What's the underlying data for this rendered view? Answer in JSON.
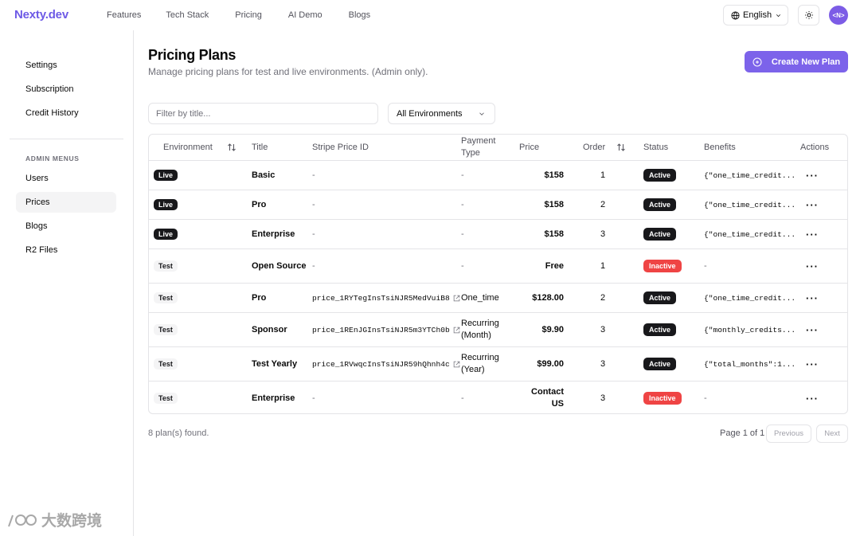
{
  "header": {
    "brand": "Nexty.dev",
    "nav": [
      "Features",
      "Tech Stack",
      "Pricing",
      "AI Demo",
      "Blogs"
    ],
    "language": "English",
    "avatar": "<N>"
  },
  "sidebar": {
    "items": [
      "Settings",
      "Subscription",
      "Credit History"
    ],
    "admin_heading": "ADMIN MENUS",
    "admin_items": [
      "Users",
      "Prices",
      "Blogs",
      "R2 Files"
    ],
    "active": "Prices"
  },
  "main": {
    "title": "Pricing Plans",
    "subtitle": "Manage pricing plans for test and live environments. (Admin only).",
    "create_label": "Create New Plan",
    "filter_placeholder": "Filter by title...",
    "env_select": "All Environments"
  },
  "table": {
    "headers": {
      "environment": "Environment",
      "title": "Title",
      "stripe_price_id": "Stripe Price ID",
      "payment_type": "Payment Type",
      "price": "Price",
      "order": "Order",
      "status": "Status",
      "benefits": "Benefits",
      "actions": "Actions"
    },
    "rows": [
      {
        "env": "Live",
        "title": "Basic",
        "stripe": "-",
        "payment": "-",
        "price": "$158",
        "order": "1",
        "status": "Active",
        "benefits": "{\"one_time_credit..."
      },
      {
        "env": "Live",
        "title": "Pro",
        "stripe": "-",
        "payment": "-",
        "price": "$158",
        "order": "2",
        "status": "Active",
        "benefits": "{\"one_time_credit..."
      },
      {
        "env": "Live",
        "title": "Enterprise",
        "stripe": "-",
        "payment": "-",
        "price": "$158",
        "order": "3",
        "status": "Active",
        "benefits": "{\"one_time_credit..."
      },
      {
        "env": "Test",
        "title": "Open Source",
        "stripe": "-",
        "payment": "-",
        "price": "Free",
        "order": "1",
        "status": "Inactive",
        "benefits": "-"
      },
      {
        "env": "Test",
        "title": "Pro",
        "stripe": "price_1RYTegInsTsiNJR5MedVuiB8",
        "payment": "One_time",
        "price": "$128.00",
        "order": "2",
        "status": "Active",
        "benefits": "{\"one_time_credit..."
      },
      {
        "env": "Test",
        "title": "Sponsor",
        "stripe": "price_1REnJGInsTsiNJR5m3YTCh0b",
        "payment": "Recurring (Month)",
        "price": "$9.90",
        "order": "3",
        "status": "Active",
        "benefits": "{\"monthly_credits..."
      },
      {
        "env": "Test",
        "title": "Test Yearly",
        "stripe": "price_1RVwqcInsTsiNJR59hQhnh4c",
        "payment": "Recurring (Year)",
        "price": "$99.00",
        "order": "3",
        "status": "Active",
        "benefits": "{\"total_months\":1..."
      },
      {
        "env": "Test",
        "title": "Enterprise",
        "stripe": "-",
        "payment": "-",
        "price": "Contact US",
        "order": "3",
        "status": "Inactive",
        "benefits": "-"
      }
    ]
  },
  "footer": {
    "count": "8 plan(s) found.",
    "page_info": "Page 1 of 1",
    "previous": "Previous",
    "next": "Next"
  },
  "watermark": "大数跨境",
  "colors": {
    "brand": "#6d5ae6",
    "primary_button": "#7c63ea",
    "active_badge": "#18181b",
    "inactive_badge": "#ef4444"
  }
}
